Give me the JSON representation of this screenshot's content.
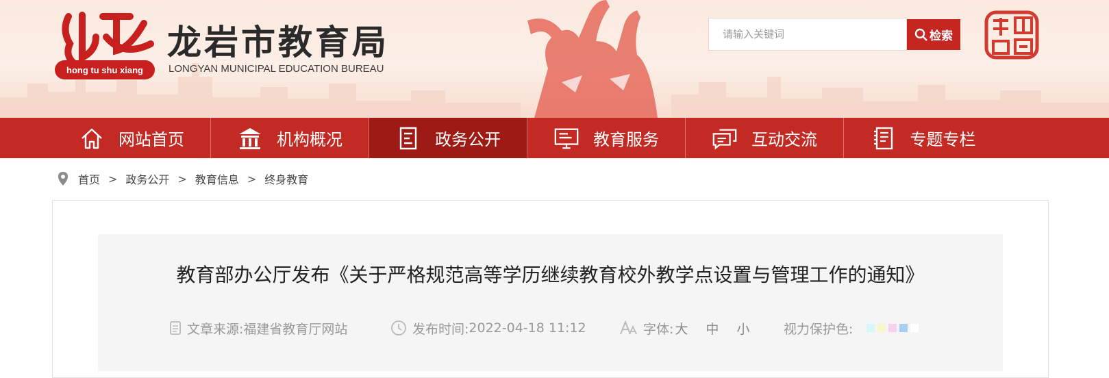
{
  "header": {
    "logo_pill_text": "hong tu shu xiang",
    "title": "龙岩市教育局",
    "subtitle": "LONGYAN MUNICIPAL EDUCATION BUREAU",
    "search_placeholder": "请输入关键词",
    "search_button": "检索",
    "seal_icon": "longyan-china-seal"
  },
  "nav": {
    "items": [
      {
        "label": "网站首页",
        "icon": "home-icon"
      },
      {
        "label": "机构概况",
        "icon": "building-icon"
      },
      {
        "label": "政务公开",
        "icon": "document-icon",
        "active": true
      },
      {
        "label": "教育服务",
        "icon": "monitor-icon"
      },
      {
        "label": "互动交流",
        "icon": "chat-icon"
      },
      {
        "label": "专题专栏",
        "icon": "notebook-icon"
      }
    ]
  },
  "breadcrumb": {
    "icon": "location-pin-icon",
    "items": [
      "首页",
      "政务公开",
      "教育信息",
      "终身教育"
    ],
    "separator": ">"
  },
  "article": {
    "title": "教育部办公厅发布《关于严格规范高等学历继续教育校外教学点设置与管理工作的通知》",
    "source_label": "文章来源:",
    "source_value": "福建省教育厅网站",
    "time_label": "发布时间:",
    "time_value": "2022-04-18 11:12",
    "font_label": "字体:",
    "font_options": [
      "大",
      "中",
      "小"
    ],
    "eye_label": "视力保护色:",
    "eye_colors": [
      "#d8f6f8",
      "#f5f8c8",
      "#f8d0f2",
      "#a8cff2",
      "#ffffff"
    ]
  },
  "colors": {
    "brand_red": "#c32a24",
    "active_red": "#9e1a15"
  }
}
